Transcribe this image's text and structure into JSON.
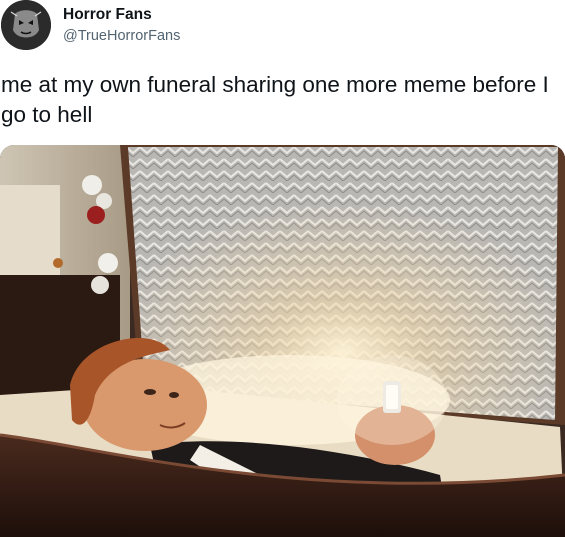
{
  "author": {
    "display_name": "Horror Fans",
    "handle": "@TrueHorrorFans",
    "avatar_icon": "horror-mask-avatar"
  },
  "tweet": {
    "text": "me at my own funeral sharing one more meme before I go to hell"
  },
  "media": {
    "icon": "photo-image"
  },
  "colors": {
    "text": "#0f1419",
    "secondary_text": "#536471",
    "background": "#ffffff"
  }
}
